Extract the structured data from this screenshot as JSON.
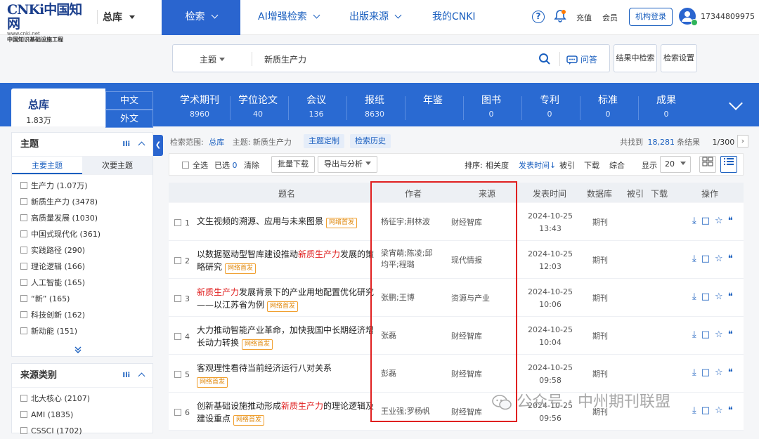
{
  "header": {
    "logo_main": "CNKi中国知网",
    "logo_url": "www.cnki.net",
    "logo_sub": "中国知识基础设施工程",
    "library": "总库",
    "nav": [
      "检索",
      "AI增强检索",
      "出版来源",
      "我的CNKI"
    ],
    "help": "?",
    "recharge": "充值",
    "member": "会员",
    "org_login": "机构登录",
    "user": "17344809975"
  },
  "search": {
    "field": "主题",
    "query": "新质生产力",
    "ask": "问答",
    "in_result": "结果中检索",
    "settings": "检索设置"
  },
  "dbbar": {
    "all_label": "总库",
    "all_count": "1.83万",
    "lang_cn": "中文",
    "lang_en": "外文",
    "items": [
      {
        "label": "学术期刊",
        "count": "8960"
      },
      {
        "label": "学位论文",
        "count": "40"
      },
      {
        "label": "会议",
        "count": "136"
      },
      {
        "label": "报纸",
        "count": "8630"
      },
      {
        "label": "年鉴",
        "count": ""
      },
      {
        "label": "图书",
        "count": "0"
      },
      {
        "label": "专利",
        "count": "0"
      },
      {
        "label": "标准",
        "count": "0"
      },
      {
        "label": "成果",
        "count": "0"
      }
    ]
  },
  "sidebar": {
    "topic_title": "主题",
    "tab_main": "主要主题",
    "tab_sub": "次要主题",
    "topics": [
      "生产力 (1.07万)",
      "新质生产力 (3478)",
      "高质量发展 (1030)",
      "中国式现代化 (361)",
      "实践路径 (290)",
      "理论逻辑 (166)",
      "人工智能 (165)",
      "“新” (165)",
      "科技创新 (162)",
      "新动能 (151)"
    ],
    "source_title": "来源类别",
    "sources": [
      "北大核心 (2107)",
      "AMI (1835)",
      "CSSCI (1702)"
    ]
  },
  "results": {
    "scope_label": "检索范围:",
    "scope_value": "总库",
    "topic_label": "主题: 新质生产力",
    "topic_custom": "主题定制",
    "history": "检索历史",
    "found_label": "共找到",
    "found_count": "18,281",
    "found_suffix": "条结果",
    "page": "1/300",
    "select_all": "全选",
    "selected": "已选",
    "selected_count": "0",
    "clear": "清除",
    "batch_download": "批量下载",
    "export": "导出与分析",
    "sort_label": "排序:",
    "sort_relevance": "相关度",
    "sort_date": "发表时间",
    "sort_cited": "被引",
    "sort_download": "下载",
    "sort_overall": "综合",
    "show_label": "显示",
    "show_value": "20",
    "columns": [
      "题名",
      "作者",
      "来源",
      "发表时间",
      "数据库",
      "被引",
      "下载",
      "操作"
    ],
    "tag_label": "网络首发",
    "rows": [
      {
        "num": "1",
        "title_pre": "文生视频的溯源、应用与未来图景",
        "title_hl": "",
        "title_post": "",
        "author": "杨征宇;荆林波",
        "source": "财经智库",
        "date": "2024-10-25",
        "time": "13:43",
        "db": "期刊"
      },
      {
        "num": "2",
        "title_pre": "以数据驱动型智库建设推动",
        "title_hl": "新质生产力",
        "title_post": "发展的策略研究",
        "author": "梁宵萌;陈凌;邱均平;程璐",
        "source": "现代情报",
        "date": "2024-10-25",
        "time": "12:03",
        "db": "期刊"
      },
      {
        "num": "3",
        "title_pre": "",
        "title_hl": "新质生产力",
        "title_post": "发展背景下的产业用地配置优化研究——以江苏省为例",
        "author": "张鹏;王博",
        "source": "资源与产业",
        "date": "2024-10-25",
        "time": "10:06",
        "db": "期刊"
      },
      {
        "num": "4",
        "title_pre": "大力推动智能产业革命，加快我国中长期经济增长动力转换",
        "title_hl": "",
        "title_post": "",
        "author": "张磊",
        "source": "财经智库",
        "date": "2024-10-25",
        "time": "10:04",
        "db": "期刊"
      },
      {
        "num": "5",
        "title_pre": "客观理性看待当前经济运行八对关系",
        "title_hl": "",
        "title_post": "",
        "author": "彭磊",
        "source": "财经智库",
        "date": "2024-10-25",
        "time": "09:58",
        "db": "期刊"
      },
      {
        "num": "6",
        "title_pre": "创新基础设施推动形成",
        "title_hl": "新质生产力",
        "title_post": "的理论逻辑及建设重点",
        "author": "王业强;罗杨帆",
        "source": "财经智库",
        "date": "2024-10-25",
        "time": "09:56",
        "db": "期刊"
      }
    ]
  },
  "watermark": "公众号 · 中州期刊联盟",
  "colors": {
    "brand": "#2a65cf",
    "highlight": "#e02020",
    "tag": "#e08a10"
  }
}
